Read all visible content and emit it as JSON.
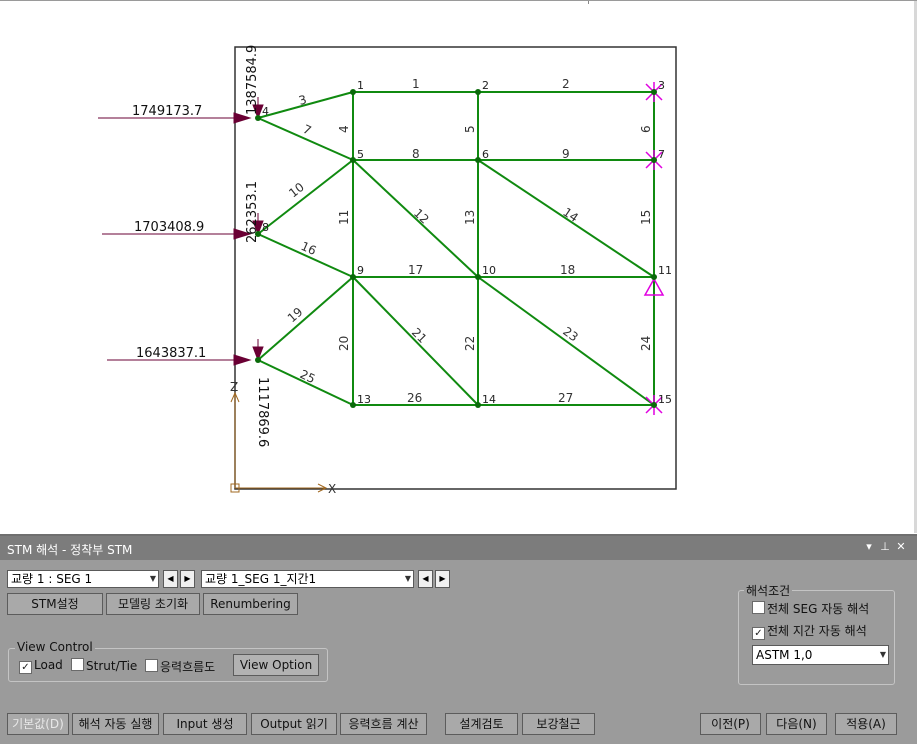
{
  "drawing": {
    "loads": [
      "1749173.7",
      "1703408.9",
      "1643837.1"
    ],
    "reactions": [
      "1387584.9",
      "262353.1",
      "1117869.6"
    ],
    "node_labels": [
      "1",
      "2",
      "3",
      "4",
      "5",
      "6",
      "7",
      "8",
      "9",
      "10",
      "11",
      "13",
      "14",
      "15"
    ],
    "member_labels": [
      "1",
      "2",
      "3",
      "4",
      "5",
      "6",
      "7",
      "8",
      "9",
      "10",
      "11",
      "12",
      "13",
      "14",
      "15",
      "16",
      "17",
      "18",
      "19",
      "20",
      "21",
      "22",
      "23",
      "24",
      "25",
      "26",
      "27"
    ],
    "axis_z": "Z",
    "axis_x": "X",
    "colors": {
      "member": "#108a10",
      "node": "#0a6a0a",
      "load": "#6a0034",
      "support": "#e000e0",
      "axis": "#a06820"
    }
  },
  "panel": {
    "title": "STM 해석 - 정착부 STM",
    "title_buttons": [
      "▾",
      "⊥",
      "✕"
    ],
    "seg_combo": "교량 1 : SEG 1",
    "span_combo": "교량 1_SEG 1_지간1",
    "buttons": {
      "stm_setting": "STM설정",
      "modeling_init": "모델링 초기화",
      "renumbering": "Renumbering",
      "view_option": "View Option",
      "default": "기본값(D)",
      "auto_run": "해석 자동 실행",
      "input_gen": "Input 생성",
      "output_read": "Output 읽기",
      "stress_flow_calc": "응력흐름 계산",
      "design_check": "설계검토",
      "reinforcement": "보강철근",
      "prev": "이전(P)",
      "next": "다음(N)",
      "apply": "적용(A)"
    },
    "view_control": {
      "label": "View Control",
      "load": "Load",
      "strut_tie": "Strut/Tie",
      "stress_flow": "응력흐름도",
      "load_checked": true,
      "strut_tie_checked": false,
      "stress_flow_checked": false
    },
    "analysis": {
      "label": "해석조건",
      "all_seg_auto": "전체 SEG 자동 해석",
      "all_span_auto": "전체 지간 자동 해석",
      "all_seg_checked": false,
      "all_span_checked": true,
      "code": "ASTM 1,0"
    }
  }
}
